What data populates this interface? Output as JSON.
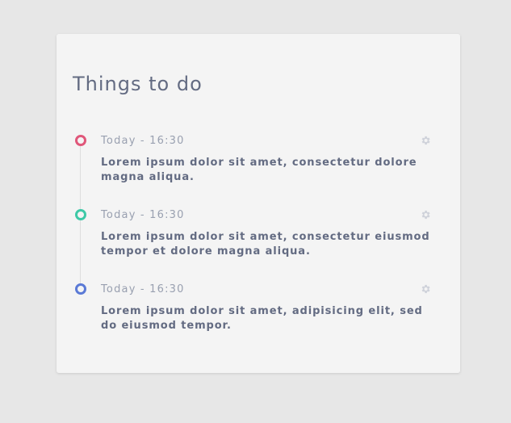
{
  "card": {
    "title": "Things to do"
  },
  "items": [
    {
      "time": "Today - 16:30",
      "text": "Lorem ipsum dolor sit amet, consectetur dolore magna aliqua.",
      "color": "#e0577a",
      "icon": "gear-icon"
    },
    {
      "time": "Today - 16:30",
      "text": "Lorem ipsum dolor sit amet, consectetur eiusmod tempor et dolore magna aliqua.",
      "color": "#3ec9a7",
      "icon": "gear-icon"
    },
    {
      "time": "Today - 16:30",
      "text": "Lorem ipsum dolor sit amet, adipisicing elit, sed do eiusmod tempor.",
      "color": "#5b7ad6",
      "icon": "gear-icon"
    }
  ]
}
